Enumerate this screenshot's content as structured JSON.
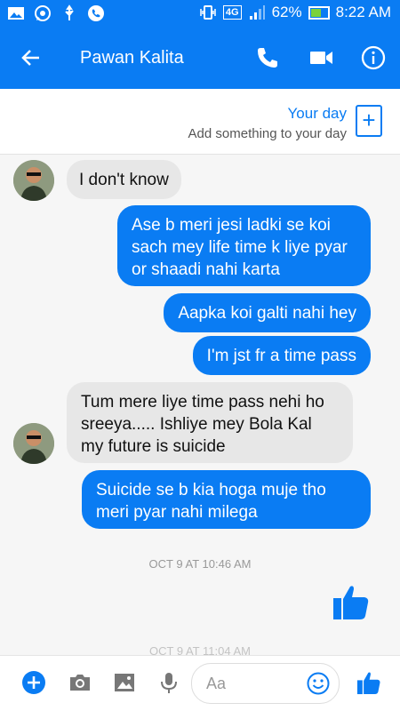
{
  "status_bar": {
    "signal_badge": "4G",
    "battery": "62%",
    "battery_level": 0.62,
    "time": "8:22 AM"
  },
  "header": {
    "contact_name": "Pawan Kalita"
  },
  "your_day": {
    "title": "Your day",
    "subtitle": "Add something to your day"
  },
  "messages": [
    {
      "from": "them",
      "text": "I don't know"
    },
    {
      "from": "me",
      "text": "Ase b meri jesi ladki se koi sach mey life time k liye pyar or shaadi nahi karta"
    },
    {
      "from": "me",
      "text": "Aapka koi galti nahi hey"
    },
    {
      "from": "me",
      "text": "I'm jst fr a time pass"
    },
    {
      "from": "them",
      "text": "Tum mere liye time pass nehi ho sreeya..... Ishliye mey Bola Kal my future is suicide"
    },
    {
      "from": "me",
      "text": "Suicide se b kia hoga muje tho meri pyar nahi milega"
    }
  ],
  "timestamps": [
    "OCT 9 AT 10:46 AM",
    "OCT 9 AT 11:04 AM"
  ],
  "composer": {
    "placeholder": "Aa"
  },
  "colors": {
    "accent": "#0a7cf3",
    "incoming_bubble": "#e7e7e7",
    "battery_fill": "#7bd23a"
  }
}
